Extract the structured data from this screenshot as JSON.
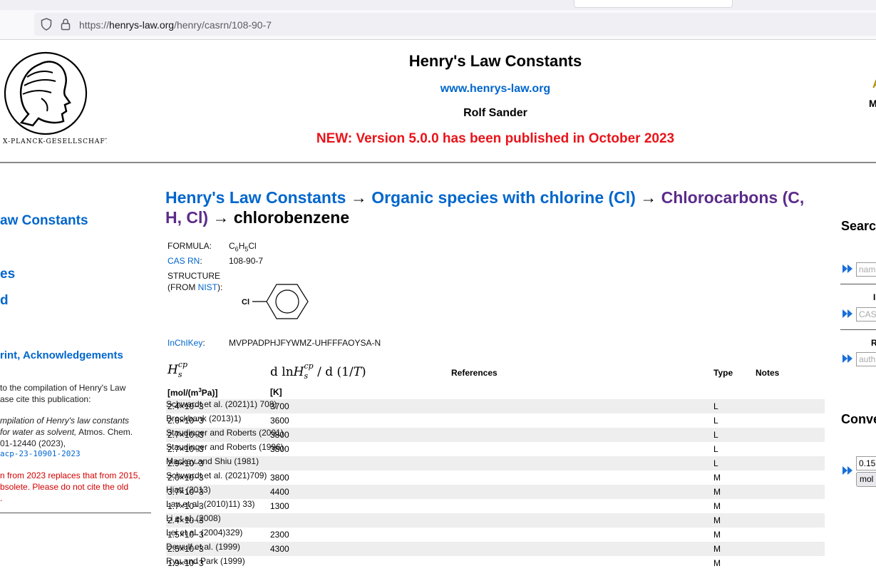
{
  "browser": {
    "url_prefix": "https://",
    "url_host": "henrys-law.org",
    "url_path": "/henry/casrn/108-90-7"
  },
  "header": {
    "logo_text": "X-PLANCK-GESELLSCHAFT",
    "title": "Henry's Law Constants",
    "site_url": "www.henrys-law.org",
    "author": "Rolf Sander",
    "news": "NEW: Version 5.0.0 has been published in October 2023",
    "right_fragment_a": "A",
    "right_fragment_b": "M"
  },
  "sidebar": {
    "link1": "aw Constants",
    "link2": "es",
    "link3": "d",
    "link4": "rint, Acknowledgements",
    "cite_line1": "to the compilation of Henry's Law",
    "cite_line2": "ase cite this publication:",
    "pub_line1": "mpilation of Henry's law constants",
    "pub_line2": "for water as solvent,",
    "pub_line2b": " Atmos. Chem.",
    "pub_line3": "01-12440 (2023),",
    "doi": "acp-23-10901-2023",
    "warn_line1": "n from 2023 replaces that from 2015,",
    "warn_line2": "bsolete. Please do not cite the old",
    "warn_line3": "."
  },
  "breadcrumb": {
    "item1": "Henry's Law Constants",
    "item2": "Organic species with chlorine (Cl)",
    "item3": "Chlorocarbons (C, H, Cl)",
    "current": "chlorobenzene",
    "separator": "→"
  },
  "substance": {
    "formula_label": "FORMULA:",
    "formula_c": "C",
    "formula_c_sub": "6",
    "formula_h": "H",
    "formula_h_sub": "5",
    "formula_cl": "Cl",
    "casrn_label": "CAS RN",
    "casrn_colon": ":",
    "casrn": "108-90-7",
    "structure_label": "STRUCTURE",
    "structure_from": "(FROM ",
    "structure_nist": "NIST",
    "structure_end": "):",
    "structure_atom": "Cl",
    "inchikey_label": "InChIKey",
    "inchikey_colon": ":",
    "inchikey": "MVPPADPHJFYWMZ-UHFFFAOYSA-N"
  },
  "table": {
    "col_hs_base": "H",
    "col_hs_sup": "cp",
    "col_hs_sub": "s",
    "col_dln_prefix": "d ln",
    "col_dln_h": "H",
    "col_dln_sup": "cp",
    "col_dln_sub": "s",
    "col_dln_suffix": " / d (1/",
    "col_dln_t": "T",
    "col_dln_close": ")",
    "col_refs": "References",
    "col_type": "Type",
    "col_notes": "Notes",
    "unit_hs_pre": "[mol/(m",
    "unit_hs_sup": "3",
    "unit_hs_post": "Pa)]",
    "unit_k": "[K]",
    "rows": [
      {
        "hs": "2.4×10−3",
        "k": "3700",
        "ref": "Schwardt et al. (2021)",
        "type": "L",
        "notes": "1) 708)"
      },
      {
        "hs": "2.6×10−3",
        "k": "3600",
        "ref": "Brockbank (2013)",
        "type": "L",
        "notes": "1)"
      },
      {
        "hs": "2.7×10−3",
        "k": "3800",
        "ref": "Staudinger and Roberts (2001)",
        "type": "L",
        "notes": ""
      },
      {
        "hs": "2.7×10−3",
        "k": "3800",
        "ref": "Staudinger and Roberts (1996)",
        "type": "L",
        "notes": ""
      },
      {
        "hs": "2.9×10−3",
        "k": "",
        "ref": "Mackay and Shiu (1981)",
        "type": "L",
        "notes": ""
      },
      {
        "hs": "2.0×10−3",
        "k": "3800",
        "ref": "Schwardt et al. (2021)",
        "type": "M",
        "notes": "709)"
      },
      {
        "hs": "3.7×10−3",
        "k": "4400",
        "ref": "Hiatt (2013)",
        "type": "M",
        "notes": ""
      },
      {
        "hs": "1.7×10−3",
        "k": "1300",
        "ref": "Lau et al. (2010)",
        "type": "M",
        "notes": "11) 33)"
      },
      {
        "hs": "2.4×10−3",
        "k": "",
        "ref": "Li et al. (2008)",
        "type": "M",
        "notes": ""
      },
      {
        "hs": "1.5×10−3",
        "k": "2300",
        "ref": "Lei et al. (2004)",
        "type": "M",
        "notes": "329)"
      },
      {
        "hs": "2.5×10−3",
        "k": "4300",
        "ref": "Dewulf et al. (1999)",
        "type": "M",
        "notes": ""
      },
      {
        "hs": "1.9×10−3",
        "k": "",
        "ref": "Ryu and Park (1999)",
        "type": "M",
        "notes": ""
      }
    ]
  },
  "right_panel": {
    "search_title": "Searc",
    "name_placeholder": "nam",
    "label_i": "I",
    "cas_placeholder": "CAS",
    "label_r": "R",
    "author_placeholder": "auth",
    "convert_title": "Conve",
    "convert_value": "0.15",
    "convert_unit": "mol"
  },
  "icons": {
    "shield": "shield-icon",
    "lock": "lock-icon",
    "fast_forward": "fast-forward-icon"
  }
}
